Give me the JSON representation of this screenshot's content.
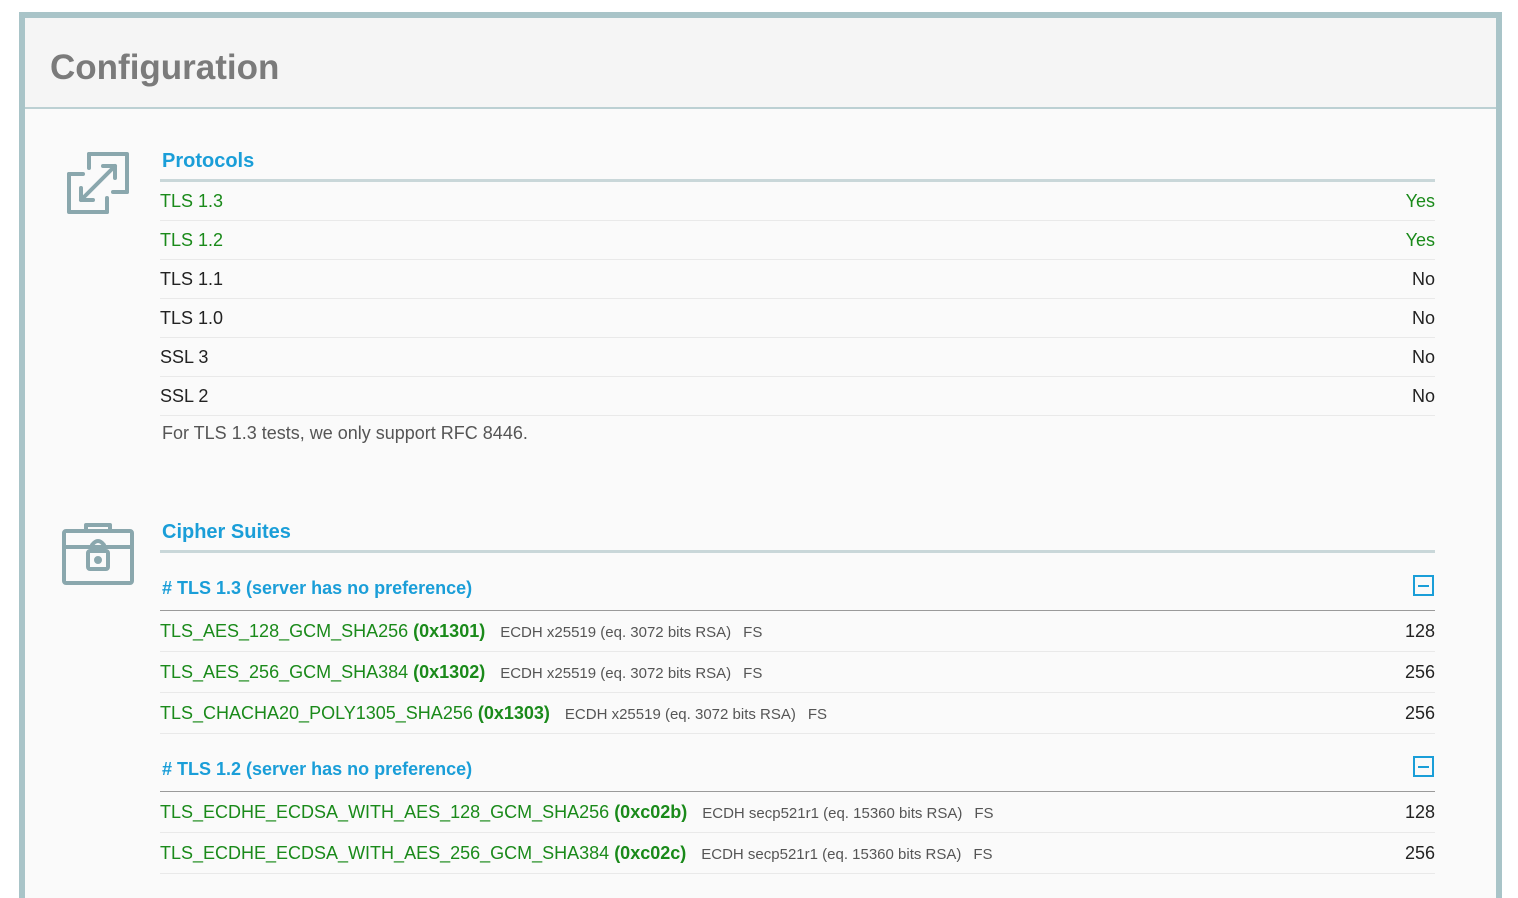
{
  "page": {
    "title": "Configuration"
  },
  "protocols": {
    "title": "Protocols",
    "icon": "expand-arrows-icon",
    "rows": [
      {
        "name": "TLS 1.3",
        "value": "Yes",
        "supported": true
      },
      {
        "name": "TLS 1.2",
        "value": "Yes",
        "supported": true
      },
      {
        "name": "TLS 1.1",
        "value": "No",
        "supported": false
      },
      {
        "name": "TLS 1.0",
        "value": "No",
        "supported": false
      },
      {
        "name": "SSL 3",
        "value": "No",
        "supported": false
      },
      {
        "name": "SSL 2",
        "value": "No",
        "supported": false
      }
    ],
    "note": "For TLS 1.3 tests, we only support RFC 8446."
  },
  "ciphers": {
    "title": "Cipher Suites",
    "icon": "toolbox-lock-icon",
    "groups": [
      {
        "title": "# TLS 1.3 (server has no preference)",
        "collapse_icon": "minus-square-icon",
        "rows": [
          {
            "name": "TLS_AES_128_GCM_SHA256",
            "code": "(0x1301)",
            "kx": "ECDH x25519 (eq. 3072 bits RSA)",
            "fs": "FS",
            "bits": "128"
          },
          {
            "name": "TLS_AES_256_GCM_SHA384",
            "code": "(0x1302)",
            "kx": "ECDH x25519 (eq. 3072 bits RSA)",
            "fs": "FS",
            "bits": "256"
          },
          {
            "name": "TLS_CHACHA20_POLY1305_SHA256",
            "code": "(0x1303)",
            "kx": "ECDH x25519 (eq. 3072 bits RSA)",
            "fs": "FS",
            "bits": "256"
          }
        ]
      },
      {
        "title": "# TLS 1.2 (server has no preference)",
        "collapse_icon": "minus-square-icon",
        "rows": [
          {
            "name": "TLS_ECDHE_ECDSA_WITH_AES_128_GCM_SHA256",
            "code": "(0xc02b)",
            "kx": "ECDH secp521r1 (eq. 15360 bits RSA)",
            "fs": "FS",
            "bits": "128"
          },
          {
            "name": "TLS_ECDHE_ECDSA_WITH_AES_256_GCM_SHA384",
            "code": "(0xc02c)",
            "kx": "ECDH secp521r1 (eq. 15360 bits RSA)",
            "fs": "FS",
            "bits": "256"
          }
        ]
      }
    ]
  },
  "colors": {
    "accent": "#1a9ed8",
    "good": "#1a8a1a",
    "border": "#a9c4c8",
    "icon": "#8aa7ad"
  }
}
